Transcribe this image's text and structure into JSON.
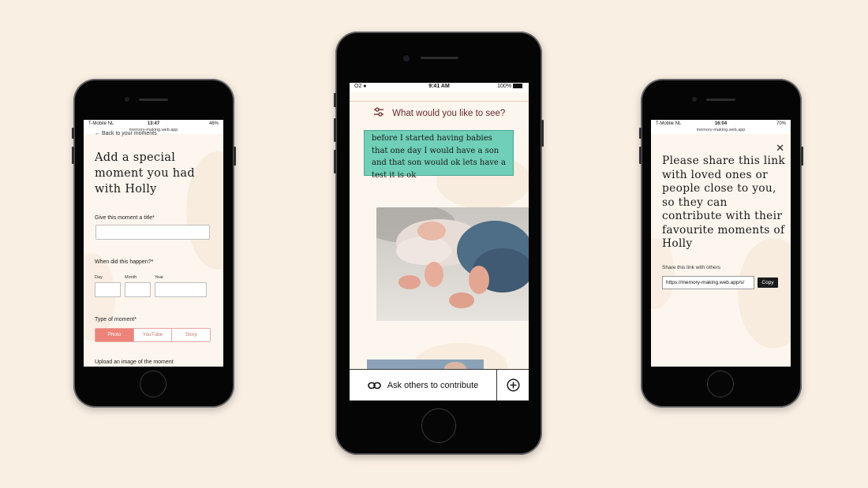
{
  "left_screen": {
    "status": {
      "carrier": "T-Mobile NL",
      "time": "13:47",
      "battery": "46%",
      "url": "memory-making.web.app"
    },
    "back_link": "Back to your moments",
    "title": "Add a special moment you had with Holly",
    "title_field_label": "Give this moment a title*",
    "date_label": "When did this happen?*",
    "date_parts": {
      "day": "Day",
      "month": "Month",
      "year": "Year"
    },
    "type_label": "Type of moment*",
    "type_options": [
      "Photo",
      "YouTube",
      "Story"
    ],
    "type_selected": "Photo",
    "upload_label": "Upload an image of the moment"
  },
  "middle_screen": {
    "status": {
      "carrier": "O2",
      "time": "9:41 AM",
      "battery": "100%"
    },
    "filter_label": "What would you like to see?",
    "note_text": "before I started having babies that one day I would have a son and that son would ok lets have a test it is ok",
    "contribute_label": "Ask others to contribute",
    "icons": {
      "filter": "sliders-icon",
      "link": "link-icon",
      "add": "plus-circle-icon"
    }
  },
  "right_screen": {
    "status": {
      "carrier": "T-Mobile NL",
      "time": "16:04",
      "battery": "70%",
      "url": "memory-making.web.app"
    },
    "title": "Please share this link with loved ones or people close to you, so they can contribute with their favourite moments of Holly",
    "share_label": "Share this link with others",
    "link_value": "https://memory-making.web.app/s/",
    "copy_label": "Copy"
  },
  "colors": {
    "background": "#faefe3",
    "accent_pink": "#ee8479",
    "note_green": "#6fcfb7",
    "filter_text": "#6a2b32"
  }
}
